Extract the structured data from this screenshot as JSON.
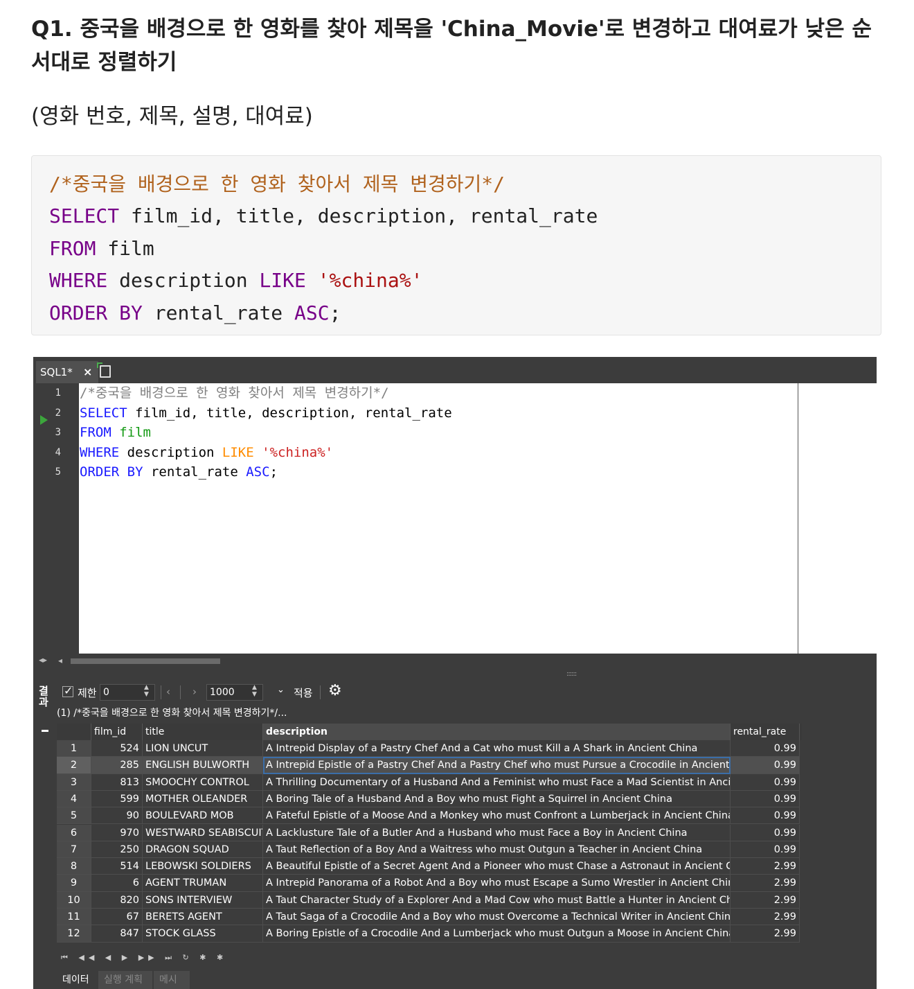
{
  "blog": {
    "question_title": "Q1. 중국을 배경으로 한 영화를 찾아 제목을 'China_Movie'로 변경하고 대여료가 낮은 순서대로 정렬하기",
    "columns_note": "(영화 번호, 제목, 설명, 대여료)",
    "code_lines": [
      [
        {
          "t": "/*중국을 배경으로 한 영화 찾아서 제목 변경하기*/",
          "c": "comment"
        }
      ],
      [
        {
          "t": "SELECT",
          "c": "kw"
        },
        {
          "t": " film_id, title, description, rental_rate",
          "c": "plain"
        }
      ],
      [
        {
          "t": "FROM",
          "c": "kw"
        },
        {
          "t": " film",
          "c": "plain"
        }
      ],
      [
        {
          "t": "WHERE",
          "c": "kw"
        },
        {
          "t": " description ",
          "c": "plain"
        },
        {
          "t": "LIKE",
          "c": "kw"
        },
        {
          "t": " ",
          "c": "plain"
        },
        {
          "t": "'%china%'",
          "c": "str"
        }
      ],
      [
        {
          "t": "ORDER",
          "c": "kw"
        },
        {
          "t": " ",
          "c": "plain"
        },
        {
          "t": "BY",
          "c": "kw"
        },
        {
          "t": " rental_rate ",
          "c": "plain"
        },
        {
          "t": "ASC",
          "c": "kw"
        },
        {
          "t": ";",
          "c": "plain"
        }
      ]
    ]
  },
  "ide": {
    "tab_label": "SQL1*",
    "tab_close": "×",
    "line_numbers": [
      "1",
      "2",
      "3",
      "4",
      "5"
    ],
    "editor_lines": [
      [
        {
          "t": "/*중국을 배경으로 한 영화 찾아서 제목 변경하기*/",
          "c": "comment"
        }
      ],
      [
        {
          "t": "SELECT",
          "c": "kw"
        },
        {
          "t": " film_id, title, description, rental_rate",
          "c": "plain"
        }
      ],
      [
        {
          "t": "FROM",
          "c": "kw"
        },
        {
          "t": " ",
          "c": "plain"
        },
        {
          "t": "film",
          "c": "tbl"
        }
      ],
      [
        {
          "t": "WHERE",
          "c": "kw"
        },
        {
          "t": " description ",
          "c": "plain"
        },
        {
          "t": "LIKE",
          "c": "like"
        },
        {
          "t": " ",
          "c": "plain"
        },
        {
          "t": "'%china%'",
          "c": "str"
        }
      ],
      [
        {
          "t": "ORDER BY",
          "c": "kw"
        },
        {
          "t": " rental_rate ",
          "c": "plain"
        },
        {
          "t": "ASC",
          "c": "kw"
        },
        {
          "t": ";",
          "c": "plain"
        }
      ]
    ],
    "result_side_label": "결과",
    "toolbar": {
      "limit_label": "제한",
      "offset_value": "0",
      "page_size_value": "1000",
      "apply_label": "적용"
    },
    "query_label": "(1) /*중국을 배경으로 한 영화 찾아서 제목 변경하기*/...",
    "grid": {
      "columns": [
        "film_id",
        "title",
        "description",
        "rental_rate"
      ],
      "selected_column": "description",
      "selected_row": 2,
      "rows": [
        [
          "1",
          "524",
          "LION UNCUT",
          "A Intrepid Display of a Pastry Chef And a Cat who must Kill a A Shark in Ancient China",
          "0.99"
        ],
        [
          "2",
          "285",
          "ENGLISH BULWORTH",
          "A Intrepid Epistle of a Pastry Chef And a Pastry Chef who must Pursue a Crocodile in Ancient China",
          "0.99"
        ],
        [
          "3",
          "813",
          "SMOOCHY CONTROL",
          "A Thrilling Documentary of a Husband And a Feminist who must Face a Mad Scientist in Ancient China",
          "0.99"
        ],
        [
          "4",
          "599",
          "MOTHER OLEANDER",
          "A Boring Tale of a Husband And a Boy who must Fight a Squirrel in Ancient China",
          "0.99"
        ],
        [
          "5",
          "90",
          "BOULEVARD MOB",
          "A Fateful Epistle of a Moose And a Monkey who must Confront a Lumberjack in Ancient China",
          "0.99"
        ],
        [
          "6",
          "970",
          "WESTWARD SEABISCUIT",
          "A Lacklusture Tale of a Butler And a Husband who must Face a Boy in Ancient China",
          "0.99"
        ],
        [
          "7",
          "250",
          "DRAGON SQUAD",
          "A Taut Reflection of a Boy And a Waitress who must Outgun a Teacher in Ancient China",
          "0.99"
        ],
        [
          "8",
          "514",
          "LEBOWSKI SOLDIERS",
          "A Beautiful Epistle of a Secret Agent And a Pioneer who must Chase a Astronaut in Ancient China",
          "2.99"
        ],
        [
          "9",
          "6",
          "AGENT TRUMAN",
          "A Intrepid Panorama of a Robot And a Boy who must Escape a Sumo Wrestler in Ancient China",
          "2.99"
        ],
        [
          "10",
          "820",
          "SONS INTERVIEW",
          "A Taut Character Study of a Explorer And a Mad Cow who must Battle a Hunter in Ancient China",
          "2.99"
        ],
        [
          "11",
          "67",
          "BERETS AGENT",
          "A Taut Saga of a Crocodile And a Boy who must Overcome a Technical Writer in Ancient China",
          "2.99"
        ],
        [
          "12",
          "847",
          "STOCK GLASS",
          "A Boring Epistle of a Crocodile And a Lumberjack who must Outgun a Moose in Ancient China",
          "2.99"
        ]
      ]
    },
    "nav_symbols": "⏮ ◀◀ ◀ ▶ ▶▶ ⏭ ↻ ✱ ✱",
    "bottom_tabs": [
      "데이터",
      "실행 계획",
      "메시지"
    ],
    "active_bottom_tab": "데이터",
    "icons": [
      "play-icon",
      "new-tab-icon",
      "gear-icon",
      "chevron-down-icon",
      "checkbox-icon"
    ]
  }
}
